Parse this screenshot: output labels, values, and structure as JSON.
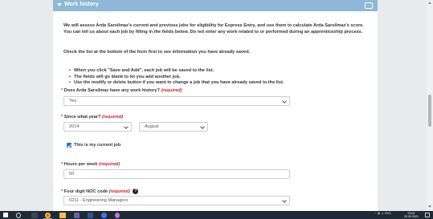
{
  "section": {
    "title": "Work history",
    "badge_icon": "toggle-icon"
  },
  "intro_text": "We will assess Arda Sarsilmaz's current and previous jobs for eligibility for Express Entry, and use them to calculate Arda Sarsilmaz's score. You can tell us about each job by filling in the fields below. Do not enter any work related to or performed during an apprenticeship process.",
  "check_list_text": "Check the list at the bottom of the form first to see information you have already saved.",
  "bullets": [
    "When you click \"Save and Add\", each job will be saved to the list.",
    "The fields will go blank to let you add another job.",
    "Use the modify or delete button if you want to change a job that you have already saved to the list."
  ],
  "questions": {
    "work_history": {
      "label": "Does Arda Sarsilmaz have any work history?",
      "required": "(required)",
      "value": "Yes"
    },
    "since_year": {
      "label": "Since what year?",
      "required": "(required)",
      "year_value": "2014",
      "month_value": "August"
    },
    "current_job": {
      "label": "This is my current job",
      "checked": true
    },
    "hours_per_week": {
      "label": "Hours per week",
      "required": "(required)",
      "value": "50"
    },
    "noc_code": {
      "label": "Four digit NOC code",
      "required": "(required)",
      "help": "?",
      "value": "0211 - Engineering Managers"
    }
  },
  "required_star": "*",
  "taskbar": {
    "clock_time": "23:02",
    "clock_date": "20.02.2021",
    "tray_lang": "ENG",
    "apps": [
      "start-icon",
      "search-icon",
      "task-view-icon",
      "chrome-icon",
      "file-explorer-icon",
      "store-icon",
      "teams-icon",
      "word-icon",
      "app-icon",
      "app-icon-2"
    ]
  },
  "colors": {
    "header": "#8db8d8",
    "required": "#cc1f1f",
    "taskbar": "#1f2a36",
    "checkbox": "#1a73e8"
  }
}
